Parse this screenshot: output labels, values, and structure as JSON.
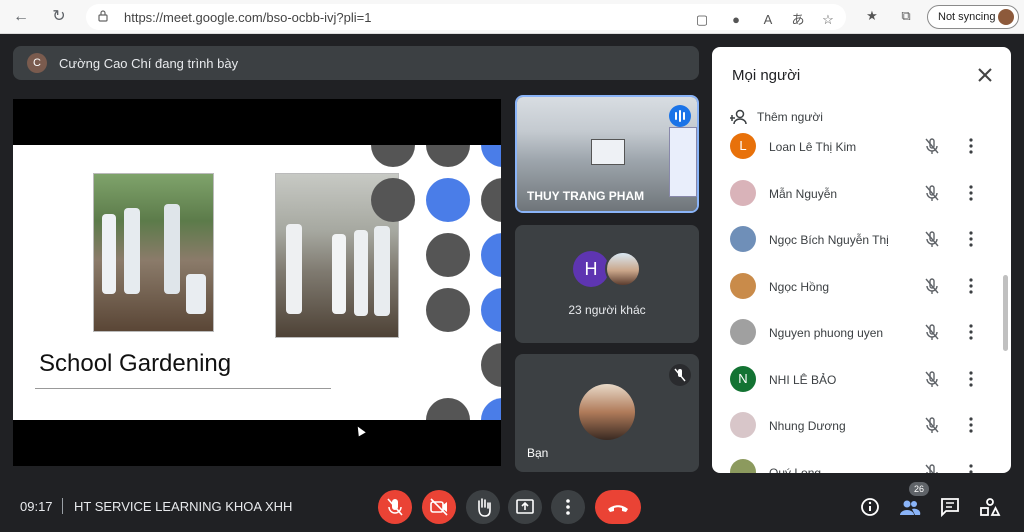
{
  "browser": {
    "url": "https://meet.google.com/bso-ocbb-ivj?pli=1",
    "sync_label": "Not syncing"
  },
  "presenter": {
    "avatar_letter": "C",
    "text": "Cường Cao Chí đang trình bày"
  },
  "slide": {
    "title": "School Gardening"
  },
  "tiles": {
    "speaker_name": "THUY TRANG PHAM",
    "others_letter": "H",
    "others_label": "23 người khác",
    "self_name": "Bạn"
  },
  "people_panel": {
    "title": "Mọi người",
    "add_label": "Thêm người",
    "people": [
      {
        "name": "Loan Lê Thị Kim",
        "letter": "L",
        "color": "#e8710a"
      },
      {
        "name": "Mẫn Nguyễn",
        "letter": "",
        "color": "#d9b3b9"
      },
      {
        "name": "Ngọc Bích Nguyễn Thị",
        "letter": "",
        "color": "#6f8fb8"
      },
      {
        "name": "Ngọc Hồng",
        "letter": "",
        "color": "#c98b4a"
      },
      {
        "name": "Nguyen phuong uyen",
        "letter": "",
        "color": "#a0a0a0"
      },
      {
        "name": "NHI LÊ BẢO",
        "letter": "N",
        "color": "#137333"
      },
      {
        "name": "Nhung Dương",
        "letter": "",
        "color": "#d8c6c9"
      },
      {
        "name": "Quý Long",
        "letter": "",
        "color": "#8c9a5e"
      }
    ]
  },
  "bottom": {
    "time": "09:17",
    "meeting_name": "HT SERVICE LEARNING KHOA XHH",
    "participants_badge": "26"
  },
  "colors": {
    "accent_blue": "#1a73e8",
    "danger_red": "#ea4335",
    "dark_surface": "#3c4043"
  }
}
